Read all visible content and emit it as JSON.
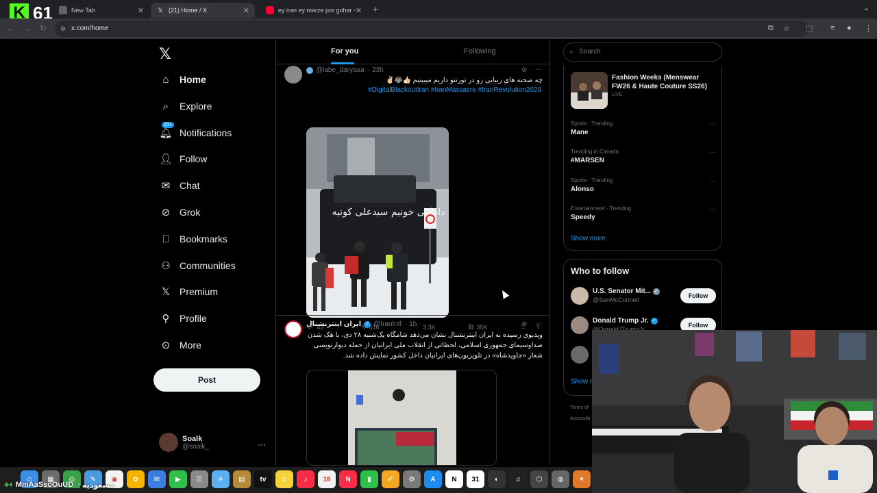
{
  "browser": {
    "stream_badge": "61",
    "tabs": [
      {
        "label": "New Tab"
      },
      {
        "label": "(21) Home / X"
      },
      {
        "label": "ey iran ey marze por gohar -"
      }
    ],
    "url": "x.com/home"
  },
  "x": {
    "nav": [
      {
        "label": "Home",
        "icon": "home-icon"
      },
      {
        "label": "Explore",
        "icon": "search-icon"
      },
      {
        "label": "Notifications",
        "icon": "bell-icon",
        "badge": "20+"
      },
      {
        "label": "Follow",
        "icon": "person-plus-icon"
      },
      {
        "label": "Chat",
        "icon": "mail-icon"
      },
      {
        "label": "Grok",
        "icon": "grok-icon"
      },
      {
        "label": "Bookmarks",
        "icon": "bookmark-icon"
      },
      {
        "label": "Communities",
        "icon": "communities-icon"
      },
      {
        "label": "Premium",
        "icon": "x-premium-icon"
      },
      {
        "label": "Profile",
        "icon": "person-icon"
      },
      {
        "label": "More",
        "icon": "more-circle-icon"
      }
    ],
    "post_label": "Post",
    "account": {
      "name": "Soalk",
      "handle": "@soalk_"
    },
    "feed_tabs": {
      "for_you": "For you",
      "following": "Following"
    },
    "tweets": [
      {
        "handle": "@labe_daryaaa",
        "time": "23h",
        "text": "چه صحنه های زیبایی رو در تورنتو داریم میبینیم 👍🏻😂✌🏻",
        "hashtags": "#DigitalBlackoutIran  #IranMassacre  #IranRevolution2026",
        "media_text": "داماهی خونیم سیدعلی کونیه",
        "replies": "42",
        "reposts": "616",
        "likes": "3.3K",
        "views": "35K"
      },
      {
        "name": "ایران اینترنشنال",
        "handle": "@IranIntl",
        "time": "1h",
        "text": "ویدیوی رسیده به ایران اینترنشنال نشان می‌دهد شامگاه یک‌شنبه ۲۸ دی، با هک شدن صداوسیمای جمهوری اسلامی، لحظاتی از انقلاب ملی ایرانیان از جمله دیوارنویسی شعار «جاویدشاه» در تلویزیون‌های ایرانیان داخل کشور نمایش داده شد."
      }
    ],
    "search_placeholder": "Search",
    "featured_trend": {
      "title": "Fashion Weeks (Menswear FW26 & Haute Couture SS26)",
      "sub": "LIVE"
    },
    "trends": [
      {
        "context": "Sports · Trending",
        "title": "Mane"
      },
      {
        "context": "Trending in Canada",
        "title": "#MARSEN"
      },
      {
        "context": "Sports · Trending",
        "title": "Alonso"
      },
      {
        "context": "Entertainment · Trending",
        "title": "Speedy"
      }
    ],
    "show_more": "Show more",
    "who_to_follow": {
      "title": "Who to follow",
      "accounts": [
        {
          "name": "U.S. Senator Mit...",
          "handle": "@SenMcConnell"
        },
        {
          "name": "Donald Trump Jr.",
          "handle": "@DonaldJTrumpJr"
        }
      ],
      "follow_label": "Follow",
      "show_more": "Show m"
    },
    "footer": [
      "Terms of",
      "Accessibi"
    ]
  },
  "overlay": {
    "ticker_name": "MmAaSsoOuUD",
    "ticker_rtl": "مسعودیه :",
    "dock_calendar": "18"
  },
  "colors": {
    "accent": "#1d9bf0",
    "bg": "#000000",
    "border": "#2f3336"
  }
}
